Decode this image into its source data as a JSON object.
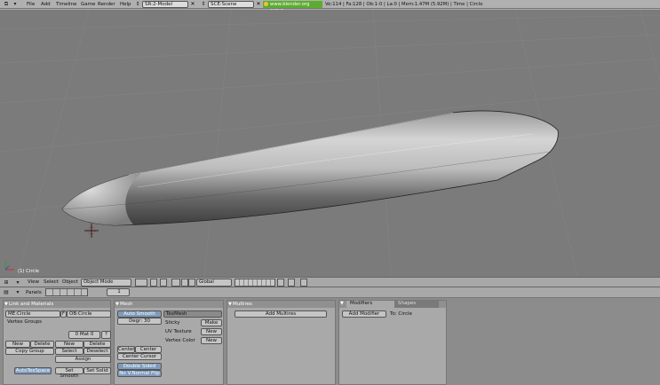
{
  "top_header": {
    "menus": [
      "File",
      "Add",
      "Timeline",
      "Game",
      "Render",
      "Help"
    ],
    "screen_field": "SR:2-Model",
    "scene_field": "SCE:Scene",
    "url": "www.blender.org 249.2",
    "stats": "Ve:114 | Fa:128 | Ob:1-0 | La:0 | Mem:1.47M (5.92M) | Time | Circle"
  },
  "viewport": {
    "object_label": "(1) Circle"
  },
  "view3d_header": {
    "menus": [
      "View",
      "Select",
      "Object"
    ],
    "mode": "Object Mode",
    "orientation": "Global"
  },
  "buttons_header": {
    "panels_label": "Panels",
    "frame": "1"
  },
  "panel_link_materials": {
    "title": "Link and Materials",
    "me_field": "ME:Circle",
    "f_label": "F",
    "ob_field": "OB:Circle",
    "vertex_groups": "Vertex Groups",
    "mat_field": "0 Mat 0",
    "mat_q": "?",
    "new_label": "New",
    "delete_label": "Delete",
    "copy_group": "Copy Group",
    "select_label": "Select",
    "deselect_label": "Deselect",
    "assign_label": "Assign",
    "autotexspace": "AutoTexSpace",
    "set_smooth": "Set Smooth",
    "set_solid": "Set Solid"
  },
  "panel_mesh": {
    "title": "Mesh",
    "auto_smooth": "Auto Smooth",
    "degr": "Degr: 30",
    "texmesh": "TexMesh",
    "sticky": "Sticky",
    "make": "Make",
    "uv_texture": "UV Texture",
    "vertex_color": "Vertex Color",
    "new_label": "New",
    "center": "Center",
    "center_new": "Center New",
    "center_cursor": "Center Cursor",
    "double_sided": "Double Sided",
    "no_v_normal_flip": "No V.Normal Flip"
  },
  "panel_multires": {
    "title": "Multires",
    "add_multires": "Add Multires"
  },
  "panel_modifiers": {
    "tab_modifiers": "Modifiers",
    "tab_shapes": "Shapes",
    "add_modifier": "Add Modifier",
    "to_label": "To: Circle"
  }
}
